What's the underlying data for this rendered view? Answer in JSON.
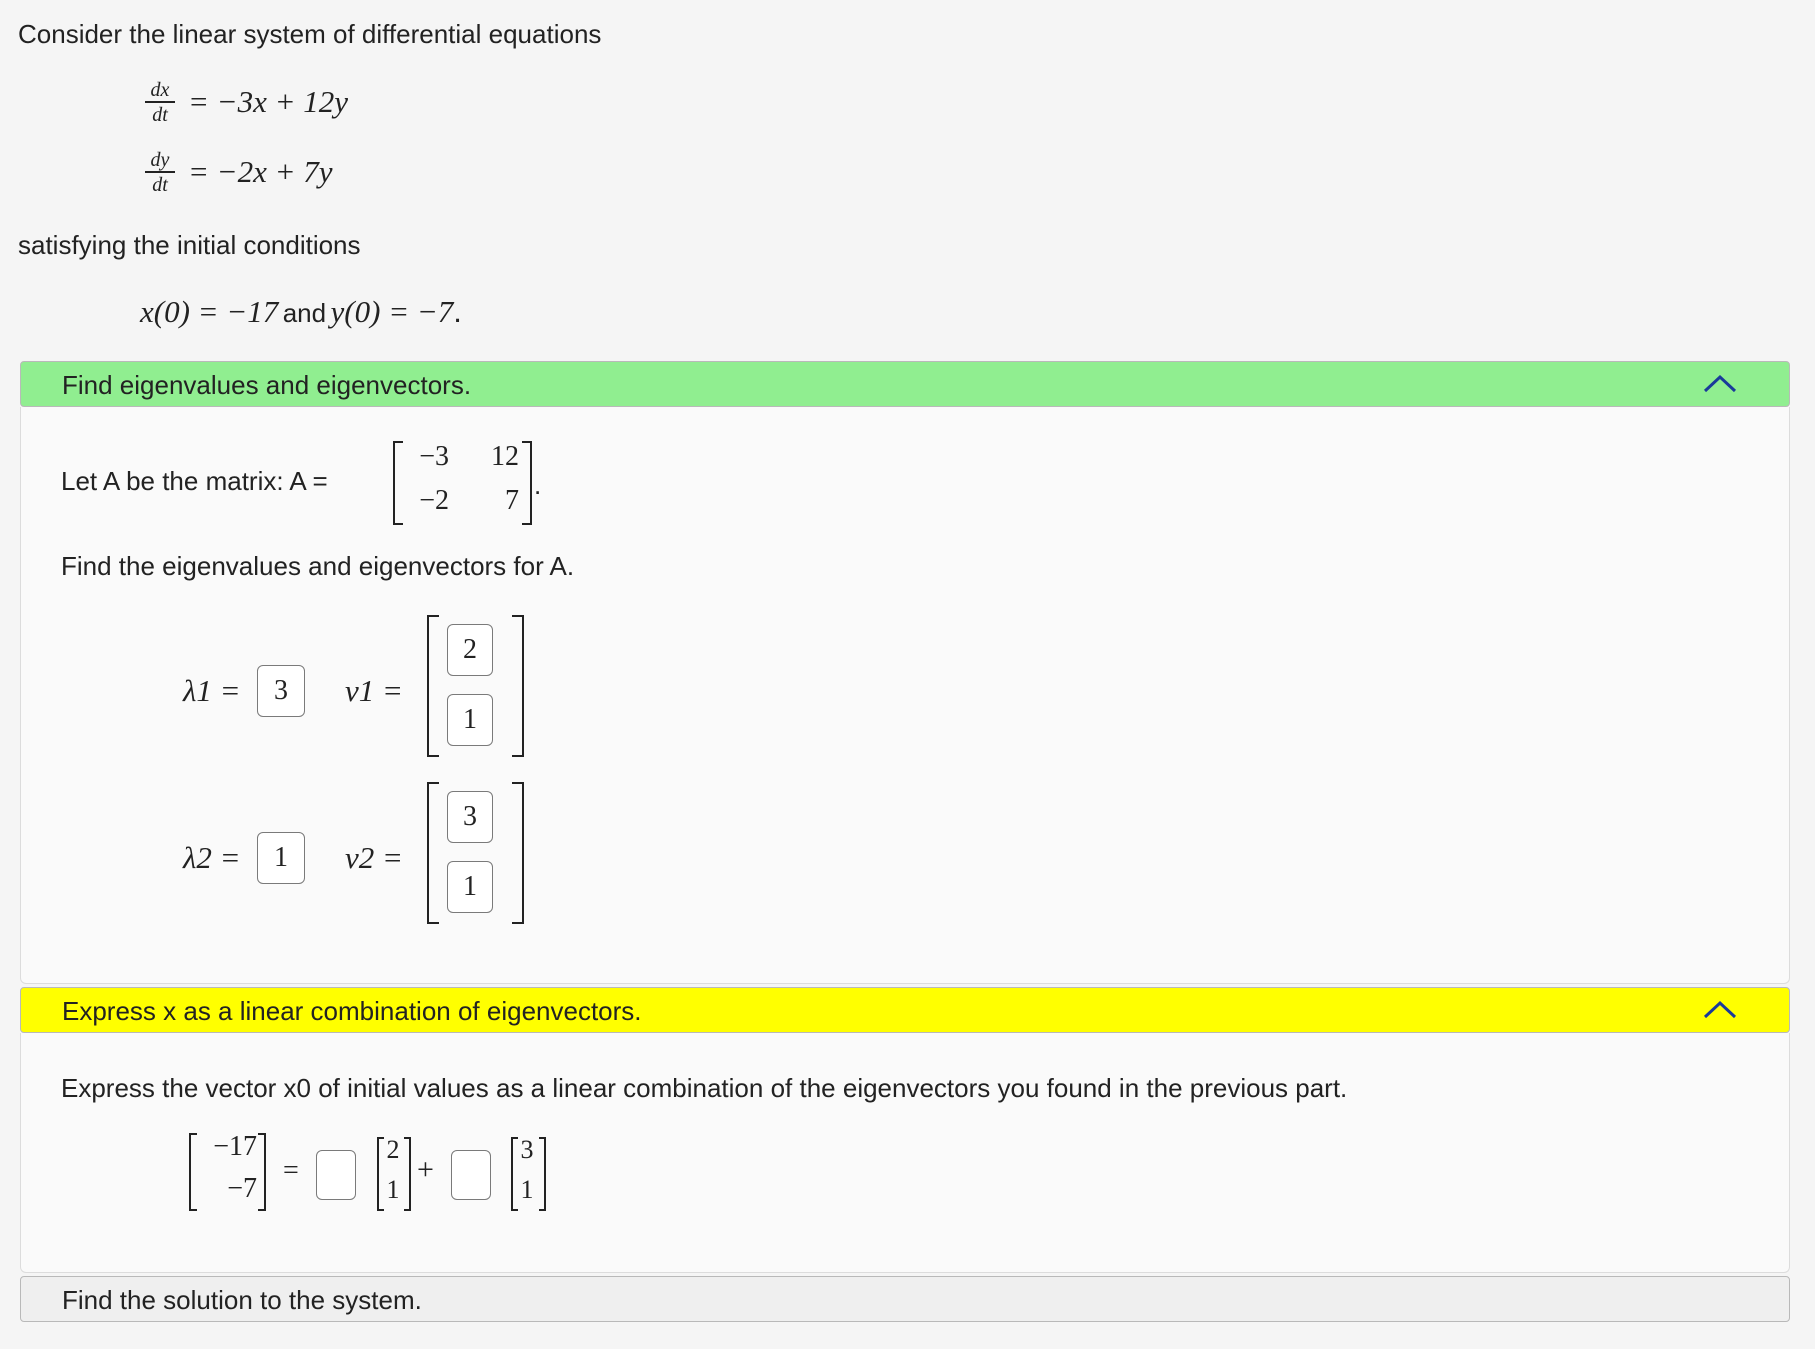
{
  "intro": {
    "line1": "Consider the linear system of differential equations",
    "eq1": {
      "num": "dx",
      "den": "dt",
      "rhs": "= −3x + 12y"
    },
    "eq2": {
      "num": "dy",
      "den": "dt",
      "rhs": "= −2x + 7y"
    },
    "line2": "satisfying the initial conditions",
    "ic": {
      "x": "x(0) = −17",
      "and": "and",
      "y": "y(0) = −7",
      "period": "."
    }
  },
  "part1": {
    "header": "Find eigenvalues and eigenvectors.",
    "header_color": "#90ee90",
    "matrix_text": "Let A be the matrix: A =",
    "matrix": [
      [
        "−3",
        "12"
      ],
      [
        "−2",
        "7"
      ]
    ],
    "matrix_period": ".",
    "prompt": "Find the eigenvalues and eigenvectors for A.",
    "lambda1_label": "λ1 =",
    "lambda1_value": "3",
    "v1_label": "v1 =",
    "v1_values": [
      "2",
      "1"
    ],
    "lambda2_label": "λ2 =",
    "lambda2_value": "1",
    "v2_label": "v2 =",
    "v2_values": [
      "3",
      "1"
    ]
  },
  "part2": {
    "header": "Express x as a linear combination of eigenvectors.",
    "header_color": "#ffff00",
    "prompt": "Express the vector x0 of initial values as a linear combination of the eigenvectors you found in the previous part.",
    "x0": [
      "−17",
      "−7"
    ],
    "eq": "=",
    "c1_value": "",
    "v1": [
      "2",
      "1"
    ],
    "plus": "+",
    "c2_value": "",
    "v2": [
      "3",
      "1"
    ]
  },
  "part3": {
    "header": "Find the solution to the system.",
    "header_color": "#efefef"
  }
}
